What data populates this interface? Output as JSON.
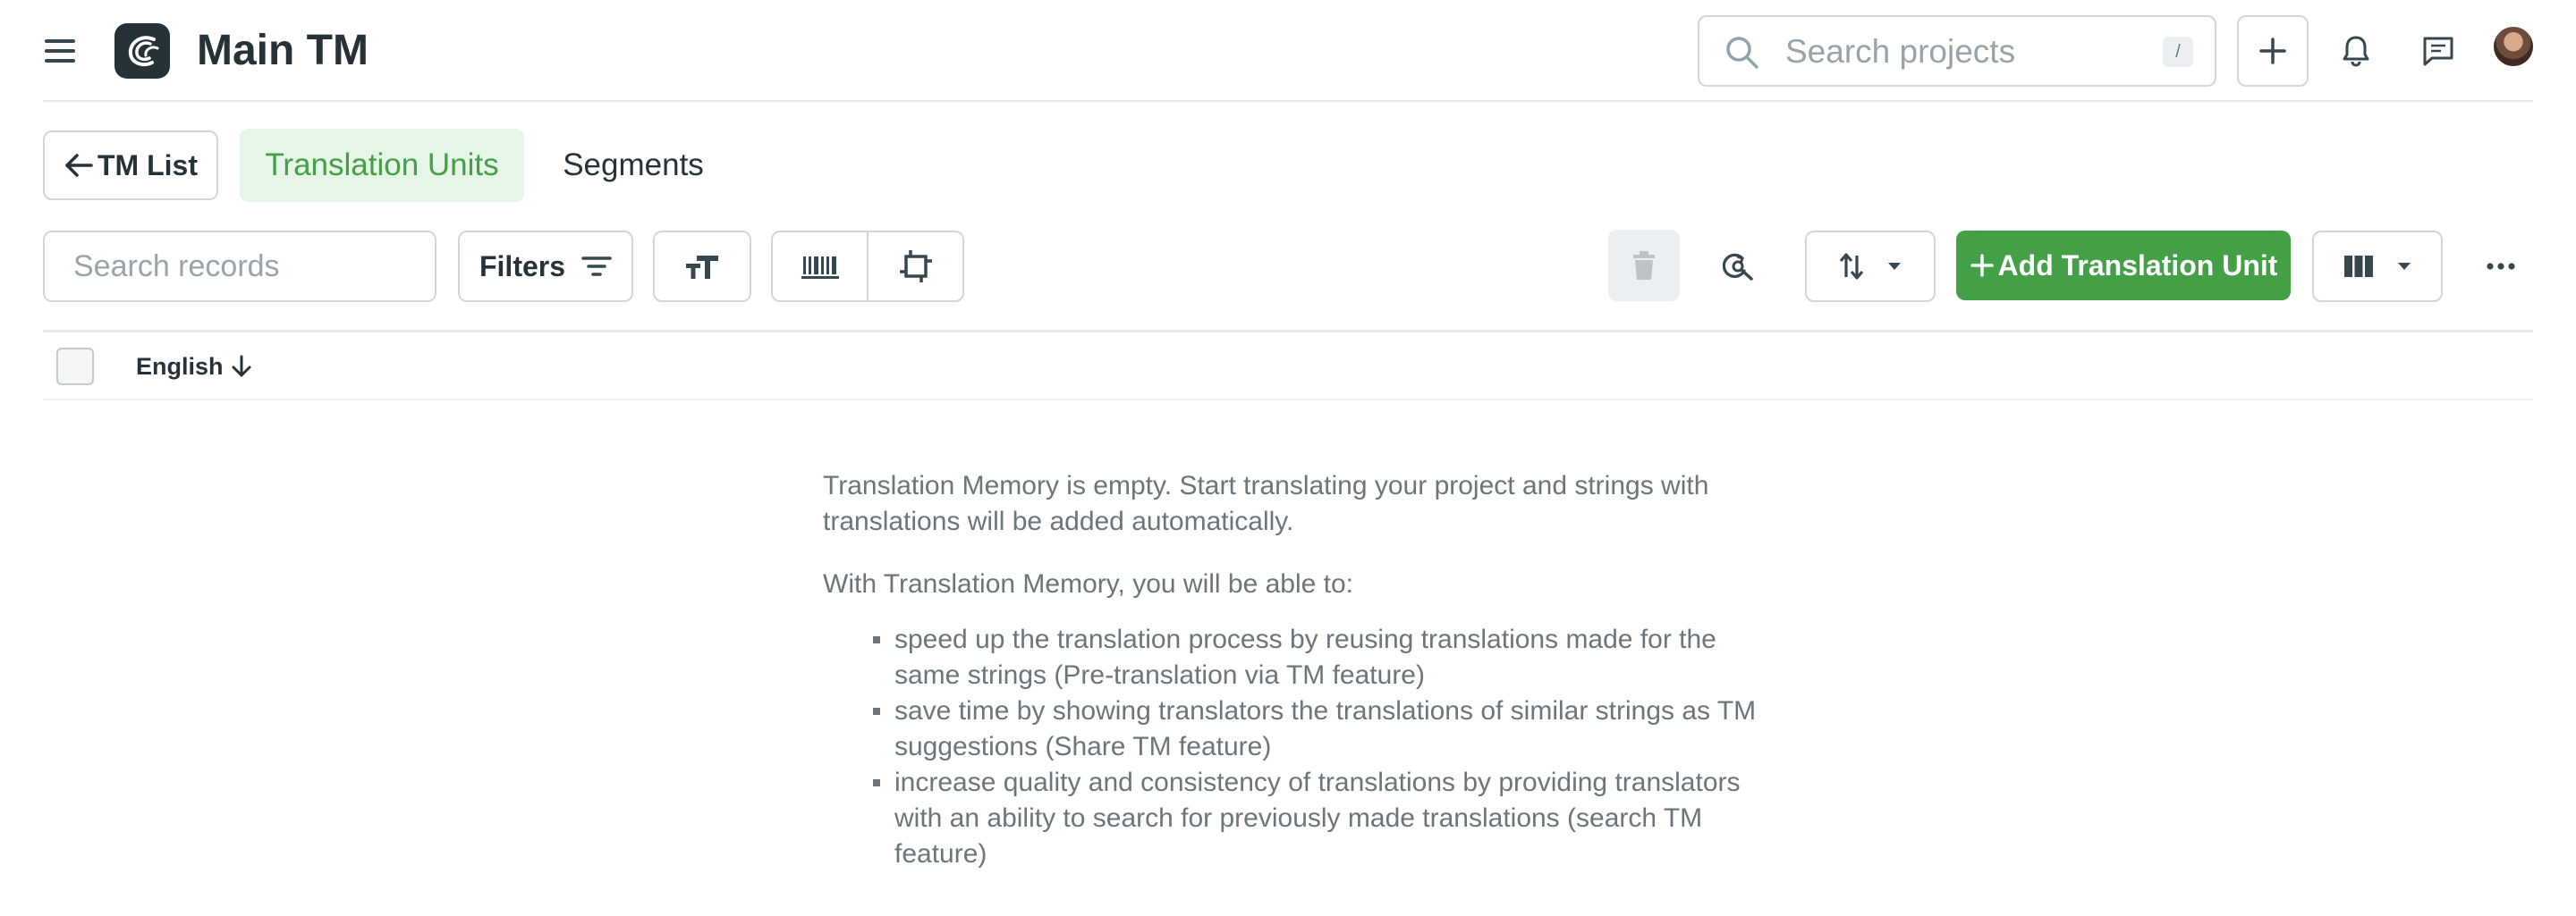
{
  "header": {
    "title": "Main TM",
    "search_placeholder": "Search projects",
    "search_shortcut": "/",
    "icons": [
      "menu-icon",
      "app-logo",
      "search-icon",
      "plus-icon",
      "bell-icon",
      "chat-icon",
      "avatar"
    ]
  },
  "nav": {
    "back_label": "TM List",
    "tabs": [
      {
        "label": "Translation Units",
        "active": true
      },
      {
        "label": "Segments",
        "active": false
      }
    ]
  },
  "toolbar": {
    "search_placeholder": "Search records",
    "filters_label": "Filters",
    "add_label": "Add Translation Unit",
    "icons": [
      "text-size-icon",
      "barcode-icon",
      "crop-icon",
      "trash-icon",
      "search-replace-icon",
      "sort-icon",
      "columns-icon",
      "more-icon"
    ]
  },
  "table": {
    "columns": [
      {
        "label": "English",
        "sort": "descending"
      }
    ]
  },
  "empty_state": {
    "line1": "Translation Memory is empty. Start translating your project and strings with translations will be added automatically.",
    "line2": "With Translation Memory, you will be able to:",
    "bullets": [
      "speed up the translation process by reusing translations made for the same strings (Pre-translation via TM feature)",
      "save time by showing translators the translations of similar strings as TM suggestions (Share TM feature)",
      "increase quality and consistency of translations by providing translators with an ability to search for previously made translations (search TM feature)"
    ]
  },
  "colors": {
    "accent_green": "#43a047",
    "active_tab_bg": "#e7f4e8",
    "text_dark": "#263238",
    "text_muted": "#6b757b",
    "border": "#d3d6d9"
  }
}
